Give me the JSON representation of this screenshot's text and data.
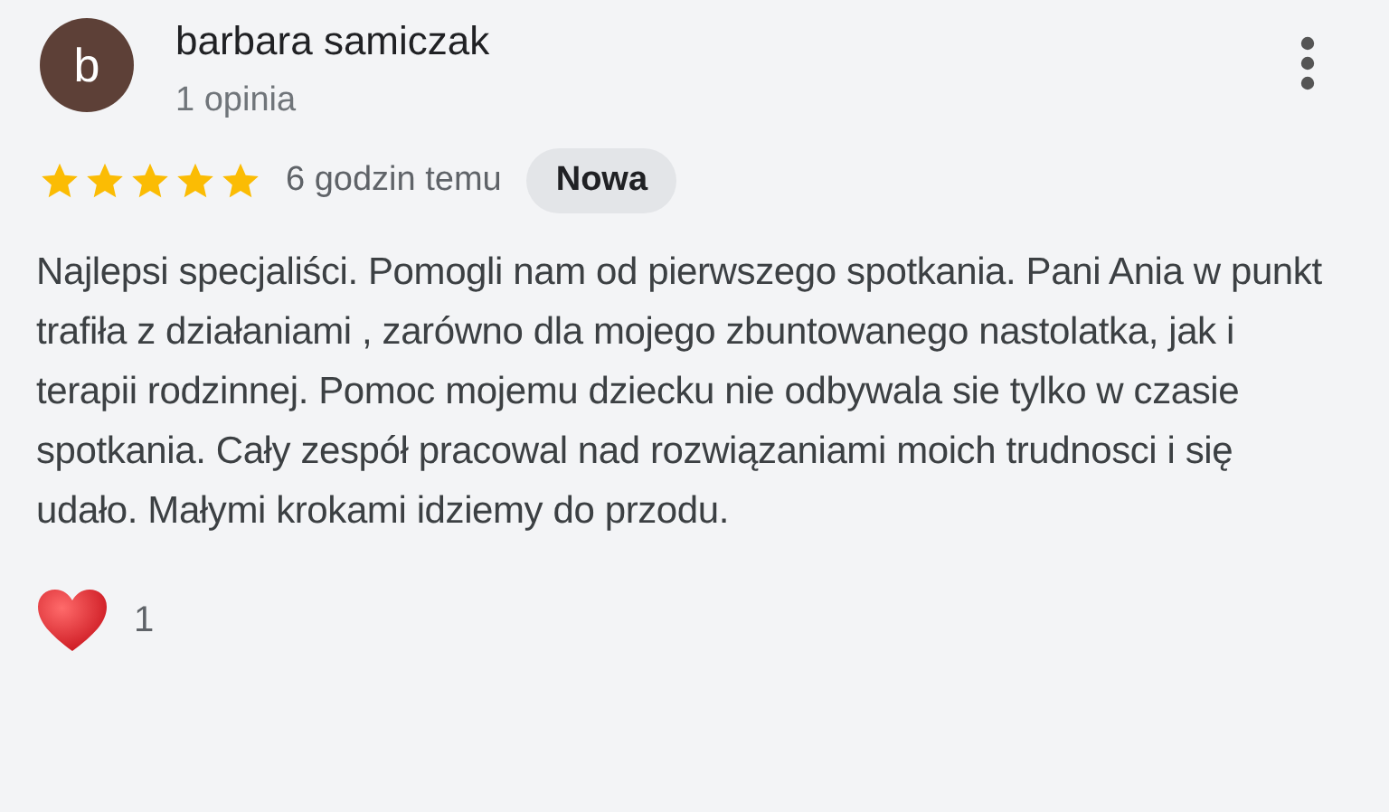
{
  "review": {
    "author": "barbara samiczak",
    "avatar_letter": "b",
    "author_meta": "1 opinia",
    "stars": 5,
    "time": "6 godzin temu",
    "badge": "Nowa",
    "text": "Najlepsi specjaliści. Pomogli nam od pierwszego spotkania. Pani Ania w punkt trafiła z działaniami , zarówno dla mojego zbuntowanego nastolatka, jak i terapii rodzinnej. Pomoc mojemu dziecku nie odbywala sie tylko w czasie spotkania. Cały zespół pracowal nad rozwiązaniami moich trudnosci i się udało. Małymi krokami idziemy do przodu.",
    "reactions": "1"
  }
}
